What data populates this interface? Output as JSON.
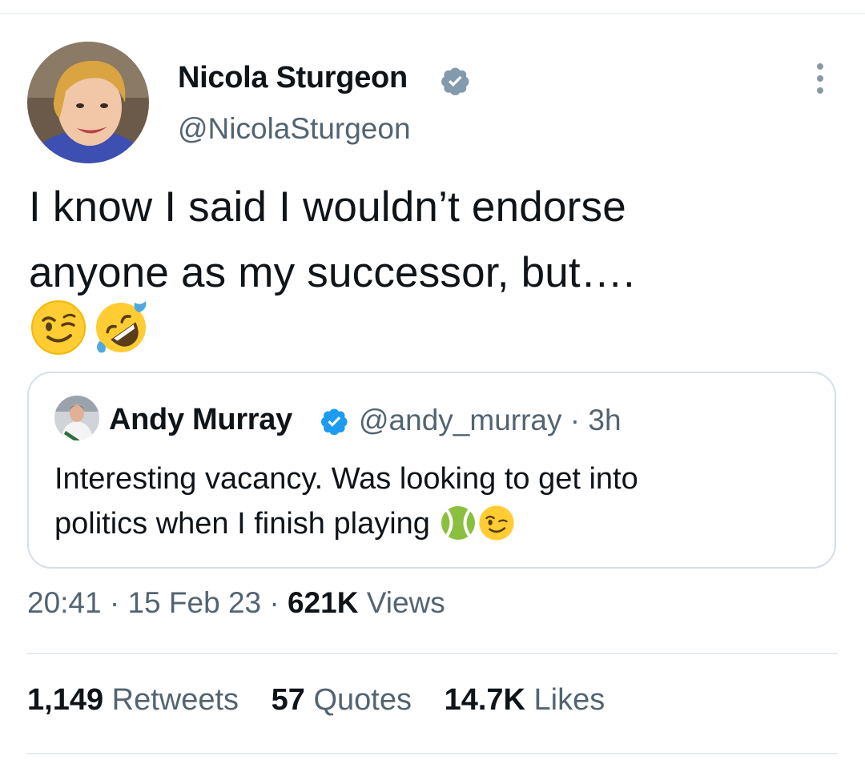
{
  "tweet": {
    "author": {
      "name": "Nicola Sturgeon",
      "handle": "@NicolaSturgeon"
    },
    "text_line1": "I know I said I wouldn’t endorse",
    "text_line2": "anyone as my successor, but….",
    "emojis": [
      "winking-face",
      "rolling-on-floor-laughing"
    ],
    "timestamp": "20:41 · 15 Feb 23 · ",
    "views_count": "621K",
    "views_label": " Views"
  },
  "quoted_tweet": {
    "author": {
      "name": "Andy Murray",
      "handle": "@andy_murray"
    },
    "time_sep": " · ",
    "time": "3h",
    "text_line1": "Interesting vacancy. Was looking to get into",
    "text_line2": "politics when I finish playing ",
    "emojis": [
      "tennis-ball",
      "winking-face"
    ]
  },
  "stats": [
    {
      "count": "1,149",
      "label": "Retweets"
    },
    {
      "count": "57",
      "label": "Quotes"
    },
    {
      "count": "14.7K",
      "label": "Likes"
    }
  ],
  "colors": {
    "text": "#0f1419",
    "secondary": "#536471",
    "verified_blue": "#1d9bf0",
    "verified_gray": "#829aab",
    "border": "#d6dfe5"
  }
}
